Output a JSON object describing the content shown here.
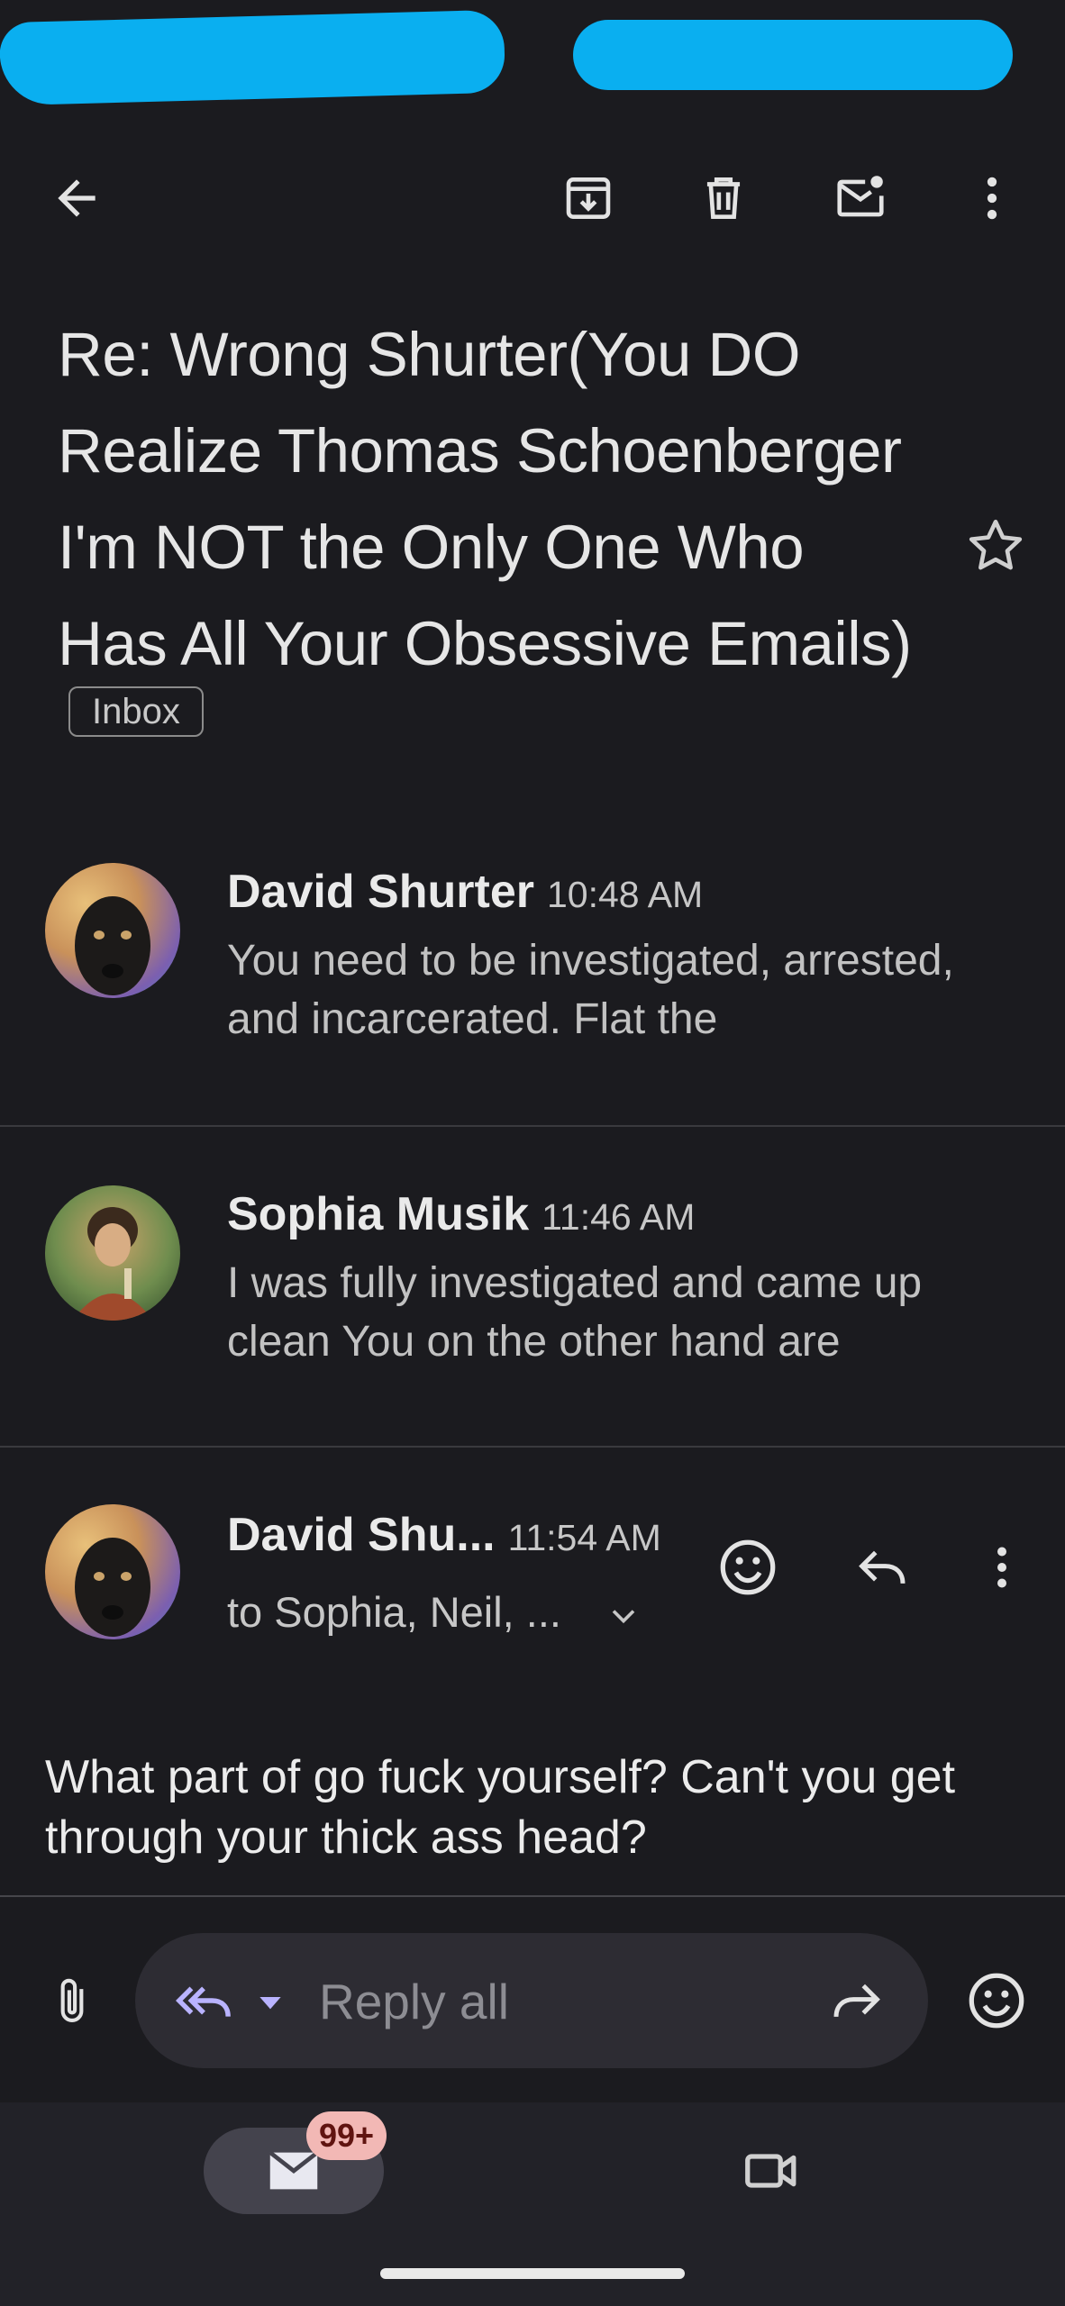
{
  "thread": {
    "subject": "Re: Wrong Shurter(You DO Realize Thomas Schoenberger I'm NOT the Only One Who Has All Your Obsessive Emails)",
    "label": "Inbox"
  },
  "toolbar": {
    "back_icon": "arrow-back-icon",
    "archive_icon": "archive-icon",
    "delete_icon": "trash-icon",
    "mark_unread_icon": "mark-unread-icon",
    "more_icon": "more-vert-icon"
  },
  "messages": [
    {
      "sender": "David Shurter",
      "time": "10:48 AM",
      "snippet": "You need to be investigated, arrested, and incarcerated. Flat the"
    },
    {
      "sender": "Sophia Musik",
      "time": "11:46 AM",
      "snippet": "I was fully investigated and came up clean You on the other hand are"
    },
    {
      "sender": "David Shu...",
      "time": "11:54 AM",
      "recipients": "to Sophia, Neil, ...",
      "body": "What part of go fuck yourself? Can't you get through your thick ass head?"
    }
  ],
  "composer": {
    "placeholder": "Reply all"
  },
  "bottom_nav": {
    "mail_badge": "99+"
  },
  "colors": {
    "background": "#1b1b1f",
    "reply_accent": "#b9b3ff",
    "badge_bg": "#f2b8b5"
  }
}
